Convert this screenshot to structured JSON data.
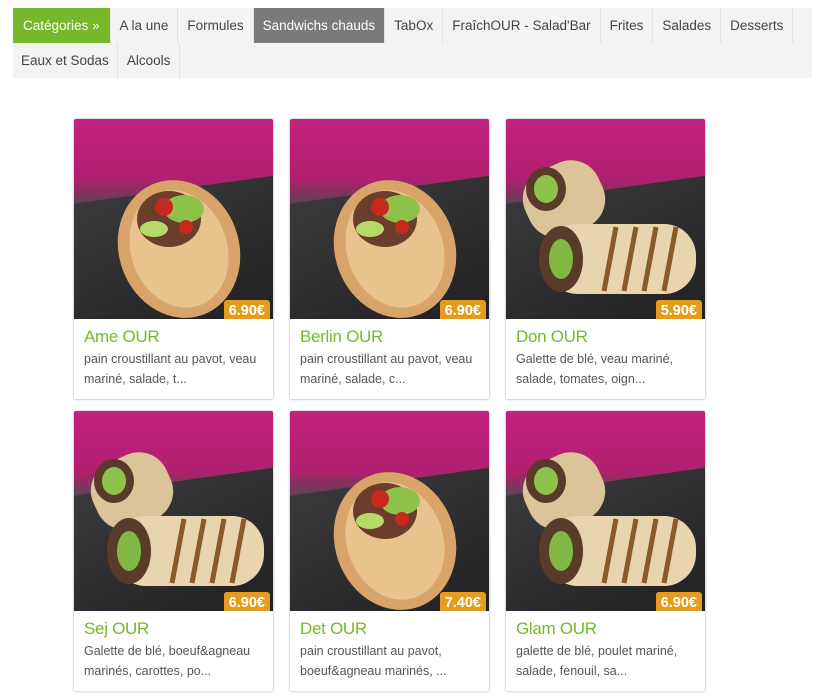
{
  "categories": {
    "header_label": "Catégories",
    "header_icon": "double-chevron-right-icon",
    "row1": [
      "A la une",
      "Formules",
      "Sandwichs chauds",
      "TabOx",
      "FraîchOUR - Salad'Bar",
      "Frites",
      "Salades",
      "Desserts"
    ],
    "row2": [
      "Eaux et Sodas",
      "Alcools"
    ],
    "active": "Sandwichs chauds"
  },
  "colors": {
    "brand_green": "#76b82a",
    "price_orange": "#e59c1c",
    "active_tab": "#7a7a7a"
  },
  "products": [
    {
      "name": "Ame OUR",
      "price": "6.90€",
      "desc1": "pain croustillant au pavot, veau",
      "desc2": "mariné, salade, t...",
      "kind": "pita"
    },
    {
      "name": "Berlin OUR",
      "price": "6.90€",
      "desc1": "pain croustillant au pavot, veau",
      "desc2": "mariné, salade, c...",
      "kind": "pita"
    },
    {
      "name": "Don OUR",
      "price": "5.90€",
      "desc1": "Galette de blé, veau mariné,",
      "desc2": "salade, tomates, oign...",
      "kind": "wrap"
    },
    {
      "name": "Sej OUR",
      "price": "6.90€",
      "desc1": "Galette de blé, boeuf&agneau",
      "desc2": "marinés, carottes, po...",
      "kind": "wrap"
    },
    {
      "name": "Det OUR",
      "price": "7.40€",
      "desc1": "pain croustillant au pavot,",
      "desc2": "boeuf&agneau marinés, ...",
      "kind": "pita"
    },
    {
      "name": "Glam OUR",
      "price": "6.90€",
      "desc1": "galette de blé, poulet mariné,",
      "desc2": "salade, fenouil, sa...",
      "kind": "wrap"
    }
  ]
}
